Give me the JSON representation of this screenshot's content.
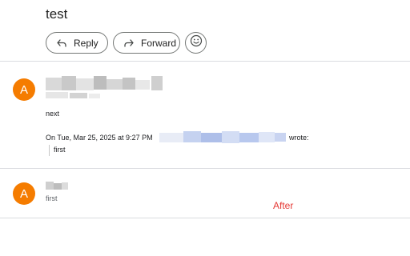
{
  "subject": "test",
  "actions": {
    "reply_label": "Reply",
    "forward_label": "Forward"
  },
  "icons": {
    "reply": "reply-arrow-icon",
    "forward": "forward-arrow-icon",
    "emoji": "smiley-face-icon"
  },
  "messages": [
    {
      "avatar_letter": "A",
      "body": "next",
      "quote_header_prefix": "On Tue, Mar 25, 2025 at 9:27 PM",
      "quote_header_suffix": "wrote:",
      "quoted_text": "first"
    },
    {
      "avatar_letter": "A",
      "snippet": "first"
    }
  ],
  "annotation": "After",
  "colors": {
    "avatar": "#f57c00",
    "annotation": "#e53935",
    "divider": "#dadce0"
  }
}
